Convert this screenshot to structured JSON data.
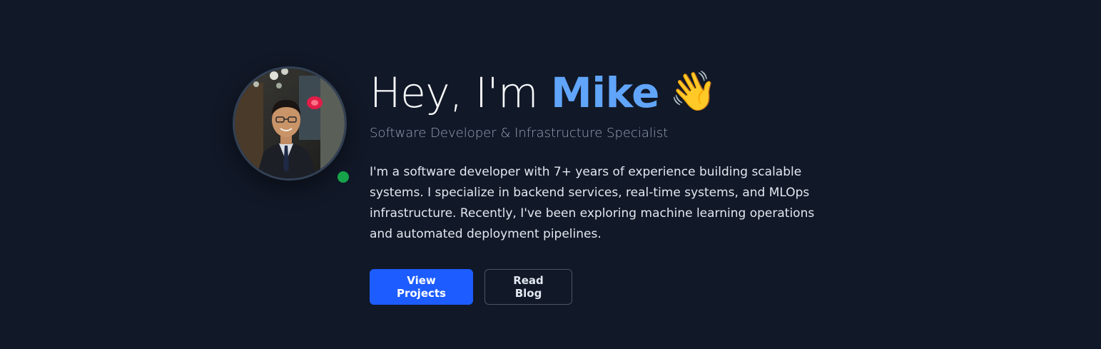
{
  "hero": {
    "greeting": "Hey, I'm ",
    "name": "Mike",
    "wave_emoji": "👋",
    "subtitle": "Software Developer & Infrastructure Specialist",
    "bio": "I'm a software developer with 7+ years of experience building scalable systems. I specialize in backend services, real-time systems, and MLOps infrastructure. Recently, I've been exploring machine learning operations and automated deployment pipelines.",
    "buttons": {
      "primary_label": "View Projects",
      "secondary_label": "Read Blog"
    },
    "status": "online"
  },
  "colors": {
    "background": "#111827",
    "accent": "#60a5fa",
    "primary_button": "#1d5cff",
    "status_online": "#16a34a"
  }
}
